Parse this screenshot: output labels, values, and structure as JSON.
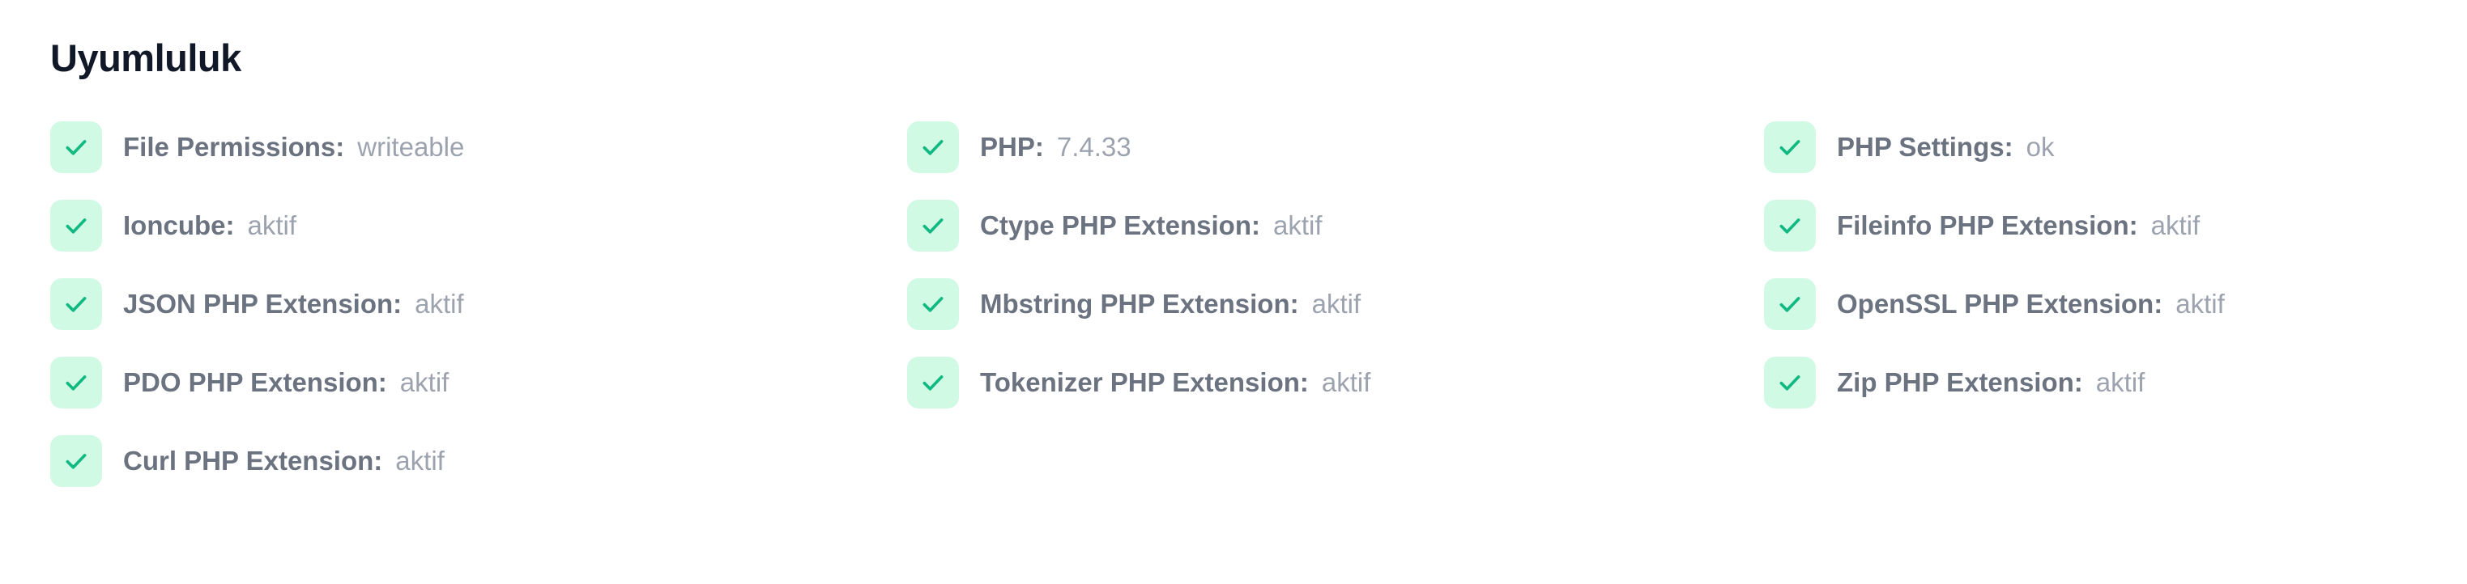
{
  "section": {
    "title": "Uyumluluk"
  },
  "colors": {
    "check_bg": "#d1fae5",
    "check_stroke": "#10b981",
    "label": "#6b7280",
    "value": "#9ca3af",
    "title": "#111827"
  },
  "checks": [
    {
      "icon": "check-icon",
      "label": "File Permissions:",
      "value": "writeable"
    },
    {
      "icon": "check-icon",
      "label": "PHP:",
      "value": "7.4.33"
    },
    {
      "icon": "check-icon",
      "label": "PHP Settings:",
      "value": "ok"
    },
    {
      "icon": "check-icon",
      "label": "Ioncube:",
      "value": "aktif"
    },
    {
      "icon": "check-icon",
      "label": "Ctype PHP Extension:",
      "value": "aktif"
    },
    {
      "icon": "check-icon",
      "label": "Fileinfo PHP Extension:",
      "value": "aktif"
    },
    {
      "icon": "check-icon",
      "label": "JSON PHP Extension:",
      "value": "aktif"
    },
    {
      "icon": "check-icon",
      "label": "Mbstring PHP Extension:",
      "value": "aktif"
    },
    {
      "icon": "check-icon",
      "label": "OpenSSL PHP Extension:",
      "value": "aktif"
    },
    {
      "icon": "check-icon",
      "label": "PDO PHP Extension:",
      "value": "aktif"
    },
    {
      "icon": "check-icon",
      "label": "Tokenizer PHP Extension:",
      "value": "aktif"
    },
    {
      "icon": "check-icon",
      "label": "Zip PHP Extension:",
      "value": "aktif"
    },
    {
      "icon": "check-icon",
      "label": "Curl PHP Extension:",
      "value": "aktif"
    }
  ]
}
